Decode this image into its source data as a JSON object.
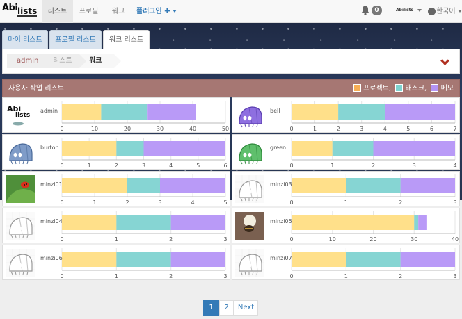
{
  "navbar": {
    "brand_top": "Abi",
    "brand_bottom": "lists",
    "items": [
      {
        "label": "리스트",
        "active": true
      },
      {
        "label": "프로필"
      },
      {
        "label": "워크"
      }
    ],
    "plugin_label": "플러그인",
    "plugin_plus": "✚",
    "notifications": "0",
    "user_logo": "Abilists",
    "language": "한국어"
  },
  "tabs": [
    "마이 리스트",
    "프로필 리스트",
    "워크 리스트"
  ],
  "breadcrumb": [
    "admin",
    "리스트",
    "워크"
  ],
  "list": {
    "title": "사용자 작업 리스트",
    "legend": [
      {
        "label": "프로젝트,",
        "color": "#f7ae55"
      },
      {
        "label": "태스크,",
        "color": "#7dd3d0"
      },
      {
        "label": "메모",
        "color": "#b494f5"
      }
    ]
  },
  "colors": {
    "project": "#ffe08a",
    "task": "#86d5d3",
    "memo": "#b99af7"
  },
  "chart_data": [
    {
      "type": "bar",
      "user": "admin",
      "avatar": "abilists-logo",
      "values": {
        "project": 12,
        "task": 14,
        "memo": 15
      },
      "xlim": [
        0,
        50
      ],
      "ticks": [
        0,
        10,
        20,
        30,
        40,
        50
      ]
    },
    {
      "type": "bar",
      "user": "bell",
      "avatar": "purple-bug",
      "values": {
        "project": 2,
        "task": 2,
        "memo": 3
      },
      "xlim": [
        0,
        7
      ],
      "ticks": [
        0,
        1,
        2,
        3,
        4,
        5,
        6,
        7
      ]
    },
    {
      "type": "bar",
      "user": "burton",
      "avatar": "blue-bug",
      "values": {
        "project": 2,
        "task": 1,
        "memo": 3
      },
      "xlim": [
        0,
        6
      ],
      "ticks": [
        0,
        1,
        2,
        3,
        4,
        5,
        6
      ]
    },
    {
      "type": "bar",
      "user": "green",
      "avatar": "green-bug",
      "values": {
        "project": 1,
        "task": 1,
        "memo": 2
      },
      "xlim": [
        0,
        4
      ],
      "ticks": [
        0,
        1,
        2,
        3,
        4
      ]
    },
    {
      "type": "bar",
      "user": "minzi01",
      "avatar": "ladybug-photo",
      "values": {
        "project": 2,
        "task": 1,
        "memo": 2
      },
      "xlim": [
        0,
        5
      ],
      "ticks": [
        0,
        1,
        2,
        3,
        4,
        5
      ]
    },
    {
      "type": "bar",
      "user": "minzi03",
      "avatar": "bug-sketch",
      "values": {
        "project": 1,
        "task": 1,
        "memo": 1
      },
      "xlim": [
        0,
        3
      ],
      "ticks": [
        0,
        1,
        2,
        3
      ]
    },
    {
      "type": "bar",
      "user": "minzi04",
      "avatar": "bug-sketch",
      "values": {
        "project": 1,
        "task": 1,
        "memo": 1
      },
      "xlim": [
        0,
        3
      ],
      "ticks": [
        0,
        1,
        2,
        3
      ]
    },
    {
      "type": "bar",
      "user": "minzi05",
      "avatar": "bee-photo",
      "values": {
        "project": 30,
        "task": 1,
        "memo": 2
      },
      "xlim": [
        0,
        40
      ],
      "ticks": [
        0,
        10,
        20,
        30,
        40
      ]
    },
    {
      "type": "bar",
      "user": "minzi06",
      "avatar": "bug-sketch",
      "values": {
        "project": 1,
        "task": 1,
        "memo": 1
      },
      "xlim": [
        0,
        3
      ],
      "ticks": [
        0,
        1,
        2,
        3
      ]
    },
    {
      "type": "bar",
      "user": "minzi07",
      "avatar": "bug-sketch",
      "values": {
        "project": 1,
        "task": 1,
        "memo": 1
      },
      "xlim": [
        0,
        3
      ],
      "ticks": [
        0,
        1,
        2,
        3
      ]
    }
  ],
  "pagination": {
    "pages": [
      "1",
      "2"
    ],
    "current": "1",
    "next": "Next"
  }
}
